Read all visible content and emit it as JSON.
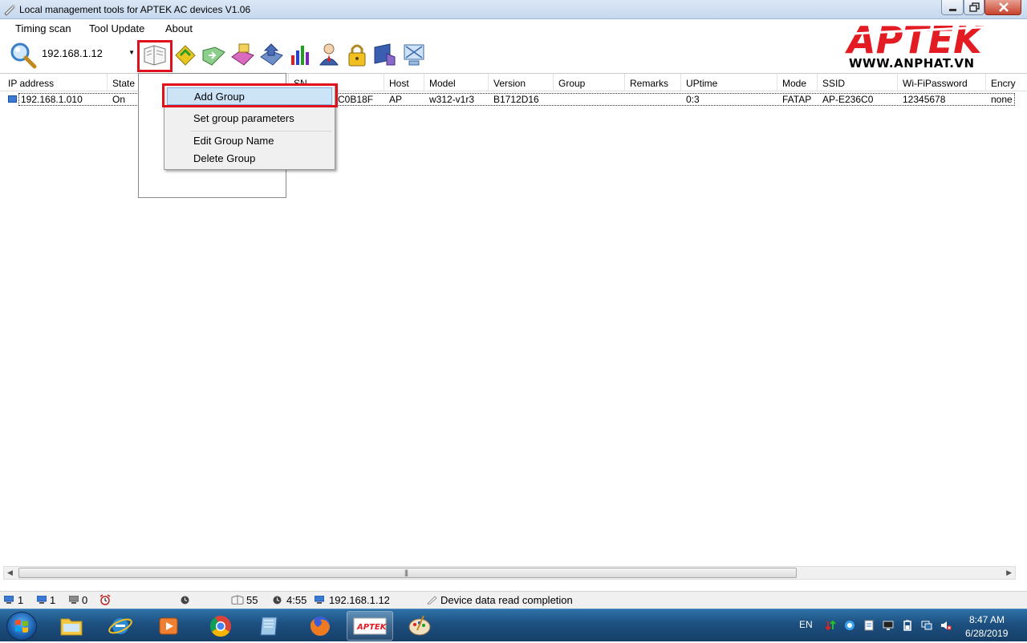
{
  "window": {
    "title": "Local management tools for APTEK AC devices  V1.06"
  },
  "menu": {
    "items": [
      "Timing scan",
      "Tool Update",
      "About"
    ]
  },
  "toolbar": {
    "ip_value": "192.168.1.12"
  },
  "logo": {
    "brand": "APTEK",
    "url": "WWW.ANPHAT.VN"
  },
  "grid": {
    "columns": [
      "IP address",
      "State",
      "SN",
      "Host",
      "Model",
      "Version",
      "Group",
      "Remarks",
      "UPtime",
      "Mode",
      "SSID",
      "Wi-FiPassword",
      "Encry"
    ],
    "rows": [
      {
        "ip": "192.168.1.010",
        "state": "On",
        "sn": "C0B18F",
        "host": "AP",
        "model": "w312-v1r3",
        "version": "B1712D16",
        "group": "",
        "remarks": "",
        "uptime": "0:3",
        "mode": "FATAP",
        "ssid": "AP-E236C0",
        "wifi_password": "12345678",
        "encry": "none"
      }
    ]
  },
  "context_menu": {
    "add_group": "Add Group",
    "set_group_parameters": "Set group parameters",
    "edit_group_name": "Edit Group Name",
    "delete_group": "Delete Group"
  },
  "statusbar": {
    "online_count": "1",
    "ap_count": "1",
    "offline_count": "0",
    "scan_count": "55",
    "elapsed": "4:55",
    "host_ip": "192.168.1.12",
    "message": "Device data read completion"
  },
  "taskbar": {
    "language": "EN",
    "time": "8:47 AM",
    "date": "6/28/2019"
  },
  "colors": {
    "highlight_red": "#e0101c",
    "logo_red": "#e31b23",
    "menu_selection": "#cde4f7"
  }
}
